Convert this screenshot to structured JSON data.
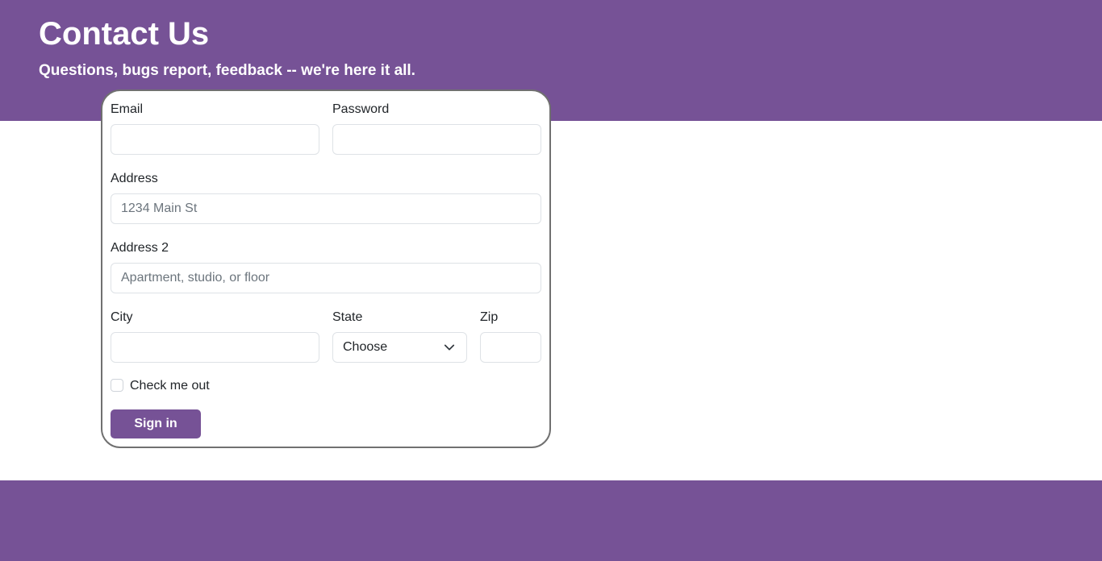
{
  "header": {
    "title": "Contact Us",
    "subtitle": "Questions, bugs report, feedback -- we're here it all."
  },
  "form": {
    "email": {
      "label": "Email",
      "value": "",
      "placeholder": ""
    },
    "password": {
      "label": "Password",
      "value": "",
      "placeholder": ""
    },
    "address": {
      "label": "Address",
      "value": "",
      "placeholder": "1234 Main St"
    },
    "address2": {
      "label": "Address 2",
      "value": "",
      "placeholder": "Apartment, studio, or floor"
    },
    "city": {
      "label": "City",
      "value": "",
      "placeholder": ""
    },
    "state": {
      "label": "State",
      "selected": "Choose",
      "icon": "chevron-down-icon"
    },
    "zip": {
      "label": "Zip",
      "value": "",
      "placeholder": ""
    },
    "checkbox": {
      "label": "Check me out",
      "checked": false
    },
    "submit_label": "Sign in"
  },
  "colors": {
    "brand": "#765296",
    "card_border": "#707070",
    "input_border": "#dee2e6",
    "text": "#212529"
  }
}
